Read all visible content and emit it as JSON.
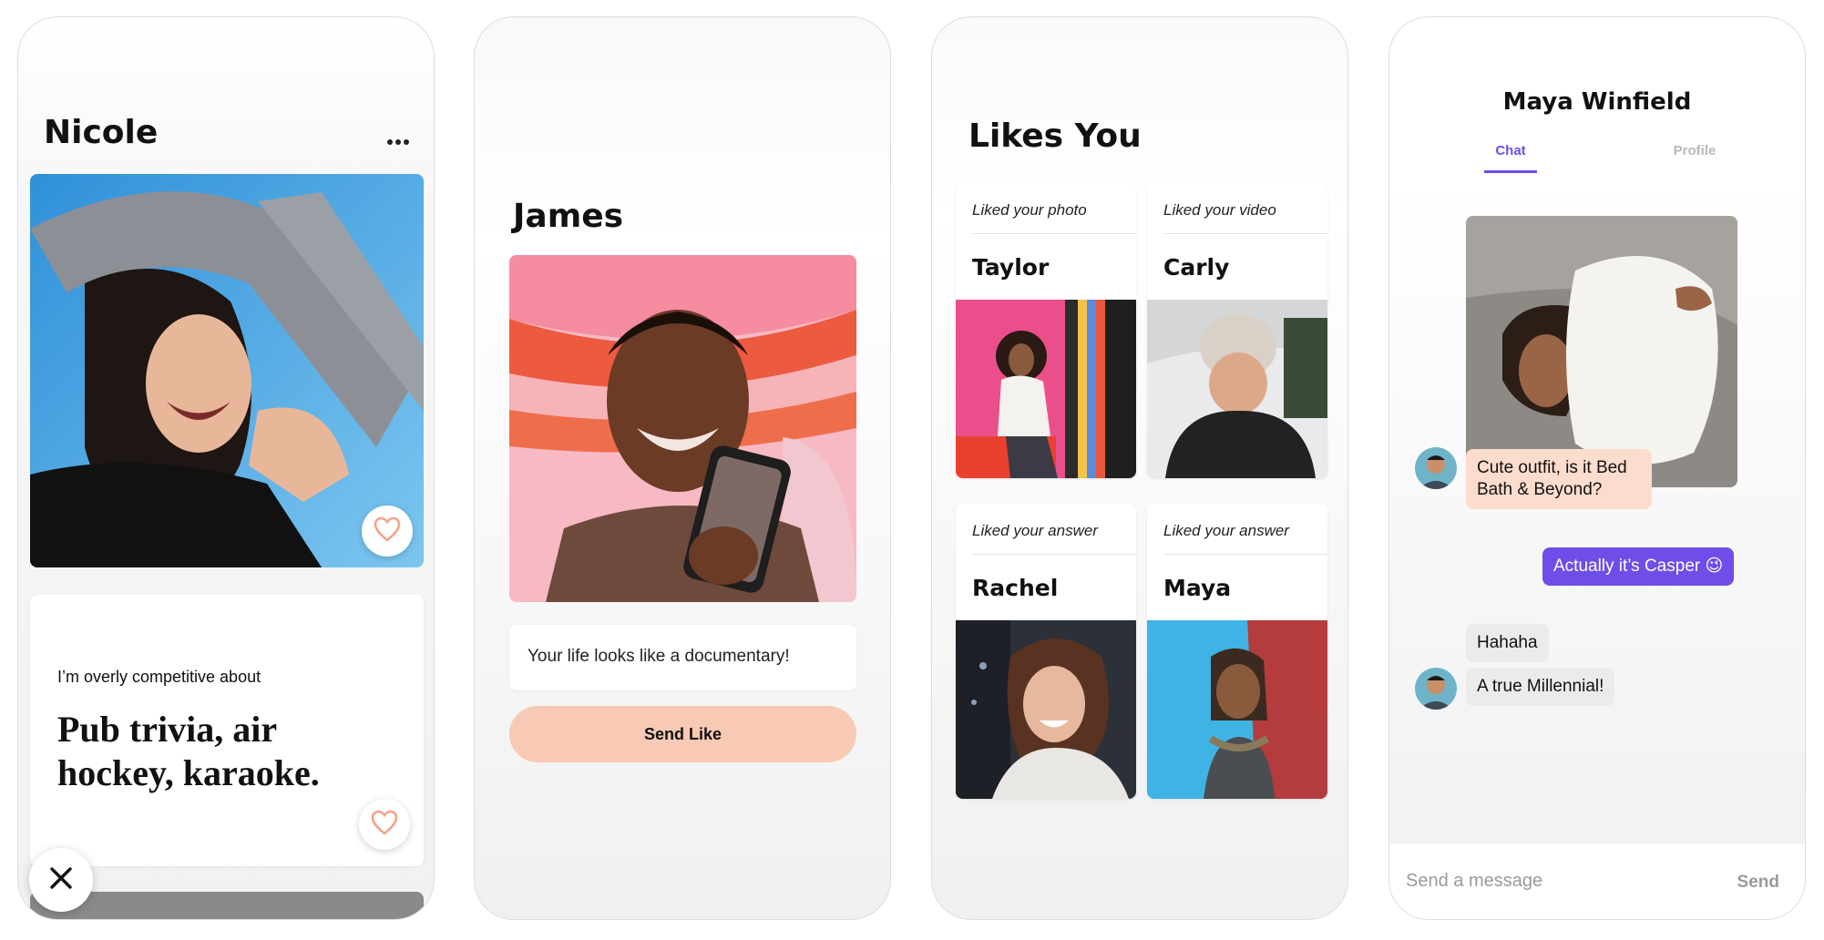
{
  "screen1": {
    "name": "Nicole",
    "menu_icon": "more-horizontal-icon",
    "prompt_label": "I’m overly competitive about",
    "prompt_answer": "Pub trivia, air hockey, karaoke.",
    "heart_icon": "heart-outline-icon",
    "close_icon": "close-x-icon",
    "accent": "#f2a58a"
  },
  "screen2": {
    "name": "James",
    "comment": "Your life looks like a documentary!",
    "send_button": "Send Like",
    "button_color": "#f8cab5"
  },
  "screen3": {
    "title": "Likes You",
    "cards": [
      {
        "caption": "Liked your photo",
        "name": "Taylor"
      },
      {
        "caption": "Liked your video",
        "name": "Carly"
      },
      {
        "caption": "Liked your answer",
        "name": "Rachel"
      },
      {
        "caption": "Liked your answer",
        "name": "Maya"
      }
    ]
  },
  "screen4": {
    "title": "Maya Winfield",
    "tabs": [
      {
        "label": "Chat"
      },
      {
        "label": "Profile"
      }
    ],
    "messages": [
      {
        "text": "Cute outfit, is it Bed Bath & Beyond?",
        "from": "them"
      },
      {
        "text": "Actually it’s Casper 😉",
        "from": "me"
      },
      {
        "text": "Hahaha",
        "from": "them"
      },
      {
        "text": "A true Millennial!",
        "from": "them"
      }
    ],
    "input_placeholder": "Send a message",
    "send_label": "Send",
    "accent": "#6f4de8"
  }
}
